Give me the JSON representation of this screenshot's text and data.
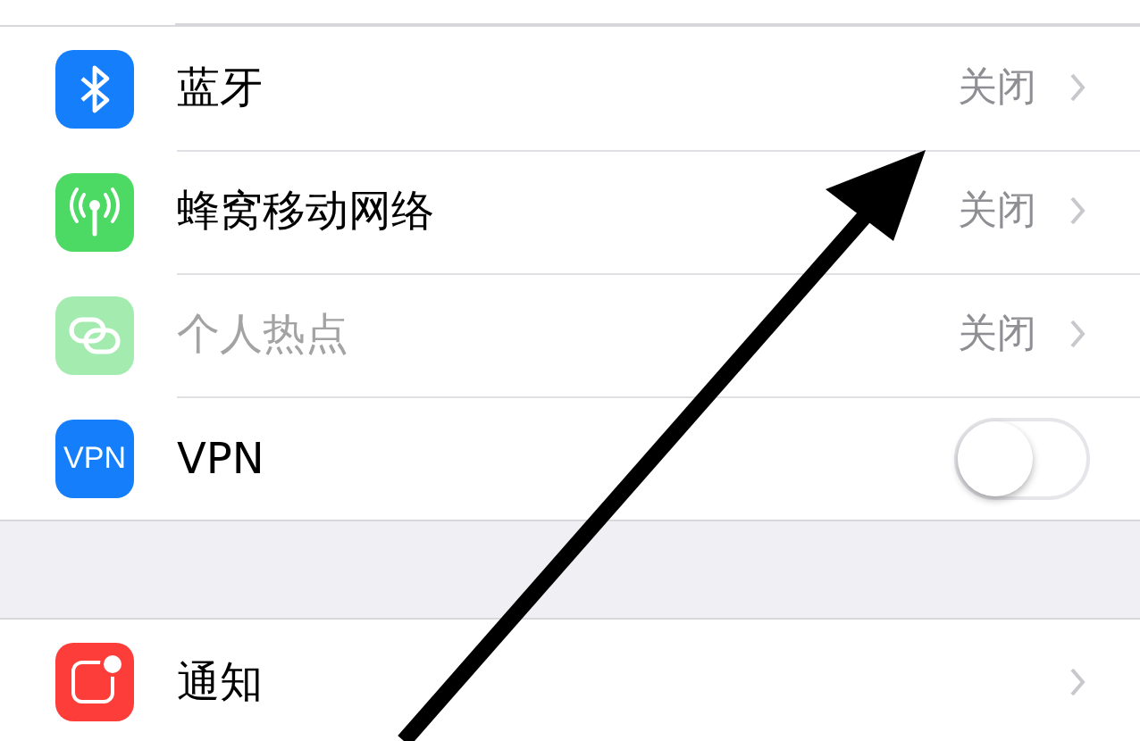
{
  "sections": [
    {
      "rows": [
        {
          "kind": "link",
          "label": "蓝牙",
          "value": "关闭",
          "disabled": false
        },
        {
          "kind": "link",
          "label": "蜂窝移动网络",
          "value": "关闭",
          "disabled": false
        },
        {
          "kind": "link",
          "label": "个人热点",
          "value": "关闭",
          "disabled": true
        },
        {
          "kind": "toggle",
          "label": "VPN",
          "icon_text": "VPN",
          "on": false,
          "disabled": false
        }
      ]
    },
    {
      "rows": [
        {
          "kind": "link",
          "label": "通知",
          "disabled": false
        }
      ]
    }
  ]
}
